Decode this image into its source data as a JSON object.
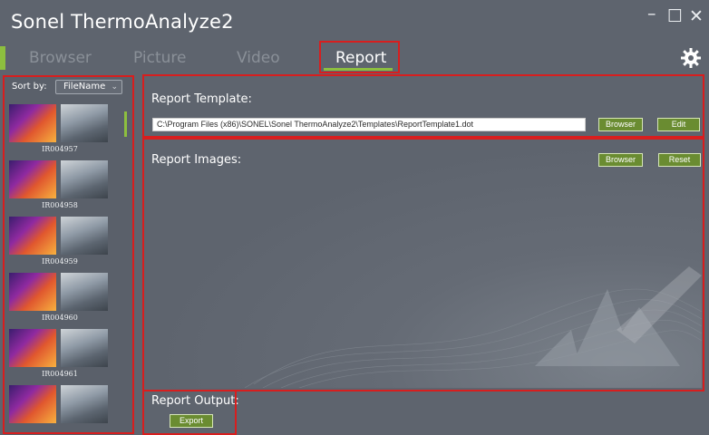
{
  "window": {
    "title": "Sonel ThermoAnalyze2",
    "controls": {
      "minimize": "–",
      "maximize": "☐",
      "close": "✕"
    }
  },
  "tabs": [
    {
      "label": "Browser",
      "active": false
    },
    {
      "label": "Picture",
      "active": false
    },
    {
      "label": "Video",
      "active": false
    },
    {
      "label": "Report",
      "active": true
    }
  ],
  "sidebar": {
    "sort_label": "Sort by:",
    "sort_value": "FileName",
    "items": [
      {
        "label": "IR004957"
      },
      {
        "label": "IR004958"
      },
      {
        "label": "IR004959"
      },
      {
        "label": "IR004960"
      },
      {
        "label": "IR004961"
      },
      {
        "label": ""
      }
    ]
  },
  "report_template": {
    "title": "Report Template:",
    "path": "C:\\Program Files (x86)\\SONEL\\Sonel ThermoAnalyze2\\Templates\\ReportTemplate1.dot",
    "browser_label": "Browser",
    "edit_label": "Edit"
  },
  "report_images": {
    "title": "Report Images:",
    "browser_label": "Browser",
    "reset_label": "Reset"
  },
  "report_output": {
    "title": "Report Output:",
    "export_label": "Export"
  },
  "colors": {
    "accent_green": "#8dbf3f",
    "button_green": "#6a8c31",
    "highlight_red": "#d81e1e",
    "background": "#5e646e"
  }
}
